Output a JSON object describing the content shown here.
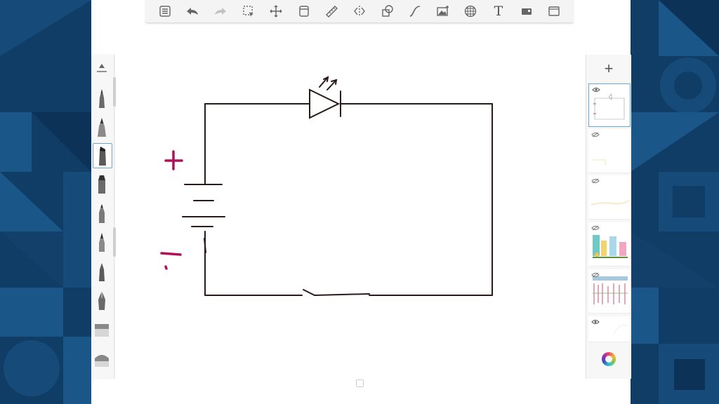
{
  "app": {
    "accent_color": "#68a9d6",
    "background_color": "#0f3d66"
  },
  "toolbar": {
    "items": [
      {
        "name": "list-icon"
      },
      {
        "name": "undo-icon"
      },
      {
        "name": "redo-icon"
      },
      {
        "name": "selection-icon"
      },
      {
        "name": "transform-icon"
      },
      {
        "name": "crop-icon"
      },
      {
        "name": "ruler-icon"
      },
      {
        "name": "symmetry-icon"
      },
      {
        "name": "shapes-icon"
      },
      {
        "name": "curve-icon"
      },
      {
        "name": "add-image-icon"
      },
      {
        "name": "perspective-grid-icon"
      },
      {
        "name": "text-icon",
        "label": "T"
      },
      {
        "name": "record-icon"
      },
      {
        "name": "fullscreen-icon"
      }
    ]
  },
  "brushes": {
    "items": [
      {
        "name": "brush-ballpoint"
      },
      {
        "name": "brush-fountain"
      },
      {
        "name": "brush-chisel-marker",
        "selected": true
      },
      {
        "name": "brush-marker"
      },
      {
        "name": "brush-pencil"
      },
      {
        "name": "brush-pen"
      },
      {
        "name": "brush-fine-liner"
      },
      {
        "name": "brush-nib"
      },
      {
        "name": "brush-eraser-flat"
      },
      {
        "name": "brush-eraser-round"
      }
    ]
  },
  "layers": {
    "add_label": "+",
    "items": [
      {
        "name": "layer-1",
        "visible": true,
        "active": true
      },
      {
        "name": "layer-2",
        "visible": false
      },
      {
        "name": "layer-3",
        "visible": false
      },
      {
        "name": "layer-4",
        "visible": false
      },
      {
        "name": "layer-5",
        "visible": false
      },
      {
        "name": "layer-6",
        "visible": true
      }
    ]
  },
  "drawing": {
    "ink_color": "#2a1a1a",
    "annotation_color": "#b0105a",
    "symbols": [
      "plus-sign",
      "minus-sign",
      "battery-symbol",
      "led-symbol",
      "switch-symbol"
    ]
  }
}
